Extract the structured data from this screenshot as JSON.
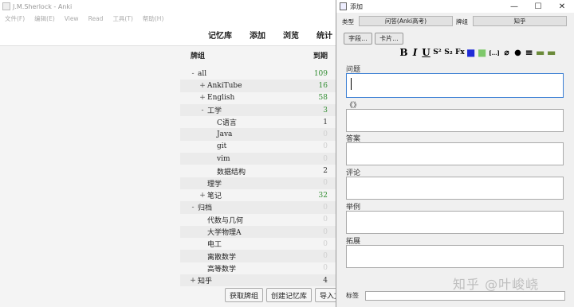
{
  "main_window": {
    "title": "J.M.Sherlock - Anki",
    "menu": [
      "文件(F)",
      "编辑(E)",
      "View",
      "Read",
      "工具(T)",
      "帮助(H)"
    ],
    "toolbar": [
      "记忆库",
      "添加",
      "浏览",
      "统计"
    ],
    "deck_header": {
      "deck": "牌组",
      "due": "到期"
    },
    "decks": [
      {
        "toggle": "-",
        "name": "all",
        "due": "109",
        "indent": 0,
        "color": "g"
      },
      {
        "toggle": "+",
        "name": "AnkiTube",
        "due": "16",
        "indent": 1,
        "color": "g"
      },
      {
        "toggle": "+",
        "name": "English",
        "due": "58",
        "indent": 1,
        "color": "g"
      },
      {
        "toggle": "-",
        "name": "工学",
        "due": "3",
        "indent": 1,
        "color": "g"
      },
      {
        "toggle": "",
        "name": "C语言",
        "due": "1",
        "indent": 2,
        "color": "d"
      },
      {
        "toggle": "",
        "name": "Java",
        "due": "0",
        "indent": 2,
        "color": "z"
      },
      {
        "toggle": "",
        "name": "git",
        "due": "0",
        "indent": 2,
        "color": "z"
      },
      {
        "toggle": "",
        "name": "vim",
        "due": "0",
        "indent": 2,
        "color": "z"
      },
      {
        "toggle": "",
        "name": "数据结构",
        "due": "2",
        "indent": 2,
        "color": "d"
      },
      {
        "toggle": "",
        "name": "理学",
        "due": "0",
        "indent": 1,
        "color": "z"
      },
      {
        "toggle": "+",
        "name": "笔记",
        "due": "32",
        "indent": 1,
        "color": "g"
      },
      {
        "toggle": "-",
        "name": "归档",
        "due": "0",
        "indent": 0,
        "color": "z"
      },
      {
        "toggle": "",
        "name": "代数与几何",
        "due": "0",
        "indent": 1,
        "color": "z"
      },
      {
        "toggle": "",
        "name": "大学物理A",
        "due": "0",
        "indent": 1,
        "color": "z"
      },
      {
        "toggle": "",
        "name": "电工",
        "due": "0",
        "indent": 1,
        "color": "z"
      },
      {
        "toggle": "",
        "name": "离散数学",
        "due": "0",
        "indent": 1,
        "color": "z"
      },
      {
        "toggle": "",
        "name": "高等数学",
        "due": "0",
        "indent": 1,
        "color": "z"
      },
      {
        "toggle": "+",
        "name": "知乎",
        "due": "4",
        "indent": 0,
        "color": "d"
      }
    ],
    "bottom_buttons": [
      "获取牌组",
      "创建记忆库",
      "导入文"
    ]
  },
  "add_window": {
    "title": "添加",
    "controls": {
      "minimize": "—",
      "maximize": "☐",
      "close": "✕"
    },
    "type_label": "类型",
    "type_value": "问答(Anki高考)",
    "deck_label": "牌组",
    "deck_value": "知乎",
    "fields_button": "字段...",
    "cards_button": "卡片...",
    "format_icons": [
      {
        "name": "bold-icon",
        "glyph": "B"
      },
      {
        "name": "italic-icon",
        "glyph": "I"
      },
      {
        "name": "underline-icon",
        "glyph": "U"
      },
      {
        "name": "superscript-icon",
        "glyph": "S²"
      },
      {
        "name": "subscript-icon",
        "glyph": "S₂"
      },
      {
        "name": "clear-format-icon",
        "glyph": "Fx"
      },
      {
        "name": "text-color-icon",
        "glyph": "■"
      },
      {
        "name": "highlight-icon",
        "glyph": "■"
      },
      {
        "name": "cloze-icon",
        "glyph": "[…]"
      },
      {
        "name": "attach-icon",
        "glyph": "⌀"
      },
      {
        "name": "record-icon",
        "glyph": "●"
      },
      {
        "name": "more-icon",
        "glyph": "≡"
      },
      {
        "name": "plugin-a-icon",
        "glyph": "▬"
      },
      {
        "name": "plugin-b-icon",
        "glyph": "▬"
      }
    ],
    "fields": [
      {
        "label": "问题"
      },
      {
        "label": "《》"
      },
      {
        "label": "答案"
      },
      {
        "label": "评论"
      },
      {
        "label": "举例"
      },
      {
        "label": "拓展"
      }
    ],
    "tags_label": "标签"
  },
  "watermark": "知乎 @叶峻峣",
  "colors": {
    "due_green": "#2e8b2e",
    "focus_blue": "#3b7fd4"
  }
}
